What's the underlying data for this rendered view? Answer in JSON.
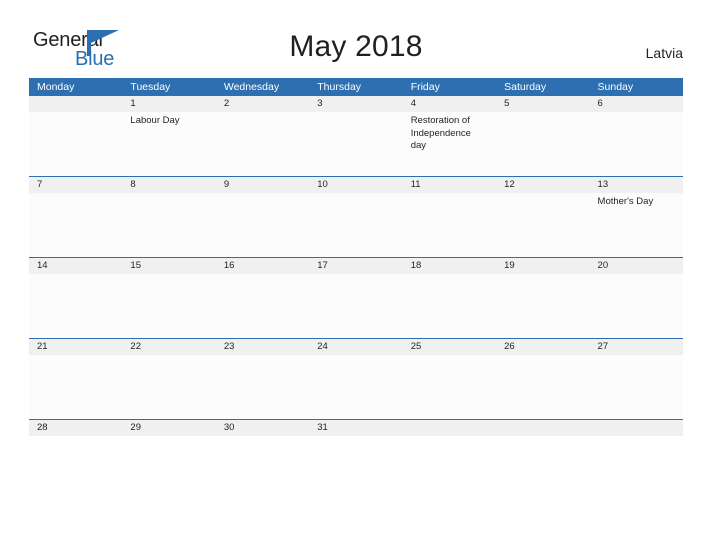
{
  "brand": {
    "name_part1": "General",
    "name_part2": "Blue",
    "logo_icon": "flag-triangle-icon",
    "color_primary": "#2a6fb0",
    "color_text": "#231f20"
  },
  "header": {
    "title": "May 2018",
    "country": "Latvia"
  },
  "calendar": {
    "header_color": "#2d6fb0",
    "date_band_color": "#f0f0f0",
    "weekdays": [
      "Monday",
      "Tuesday",
      "Wednesday",
      "Thursday",
      "Friday",
      "Saturday",
      "Sunday"
    ],
    "weeks": [
      {
        "dates": [
          "",
          "1",
          "2",
          "3",
          "4",
          "5",
          "6"
        ],
        "events": [
          "",
          "Labour Day",
          "",
          "",
          "Restoration of Independence day",
          "",
          ""
        ]
      },
      {
        "dates": [
          "7",
          "8",
          "9",
          "10",
          "11",
          "12",
          "13"
        ],
        "events": [
          "",
          "",
          "",
          "",
          "",
          "",
          "Mother's Day"
        ]
      },
      {
        "dates": [
          "14",
          "15",
          "16",
          "17",
          "18",
          "19",
          "20"
        ],
        "events": [
          "",
          "",
          "",
          "",
          "",
          "",
          ""
        ]
      },
      {
        "dates": [
          "21",
          "22",
          "23",
          "24",
          "25",
          "26",
          "27"
        ],
        "events": [
          "",
          "",
          "",
          "",
          "",
          "",
          ""
        ]
      },
      {
        "dates": [
          "28",
          "29",
          "30",
          "31",
          "",
          "",
          ""
        ],
        "events": [
          "",
          "",
          "",
          "",
          "",
          "",
          ""
        ]
      }
    ]
  }
}
